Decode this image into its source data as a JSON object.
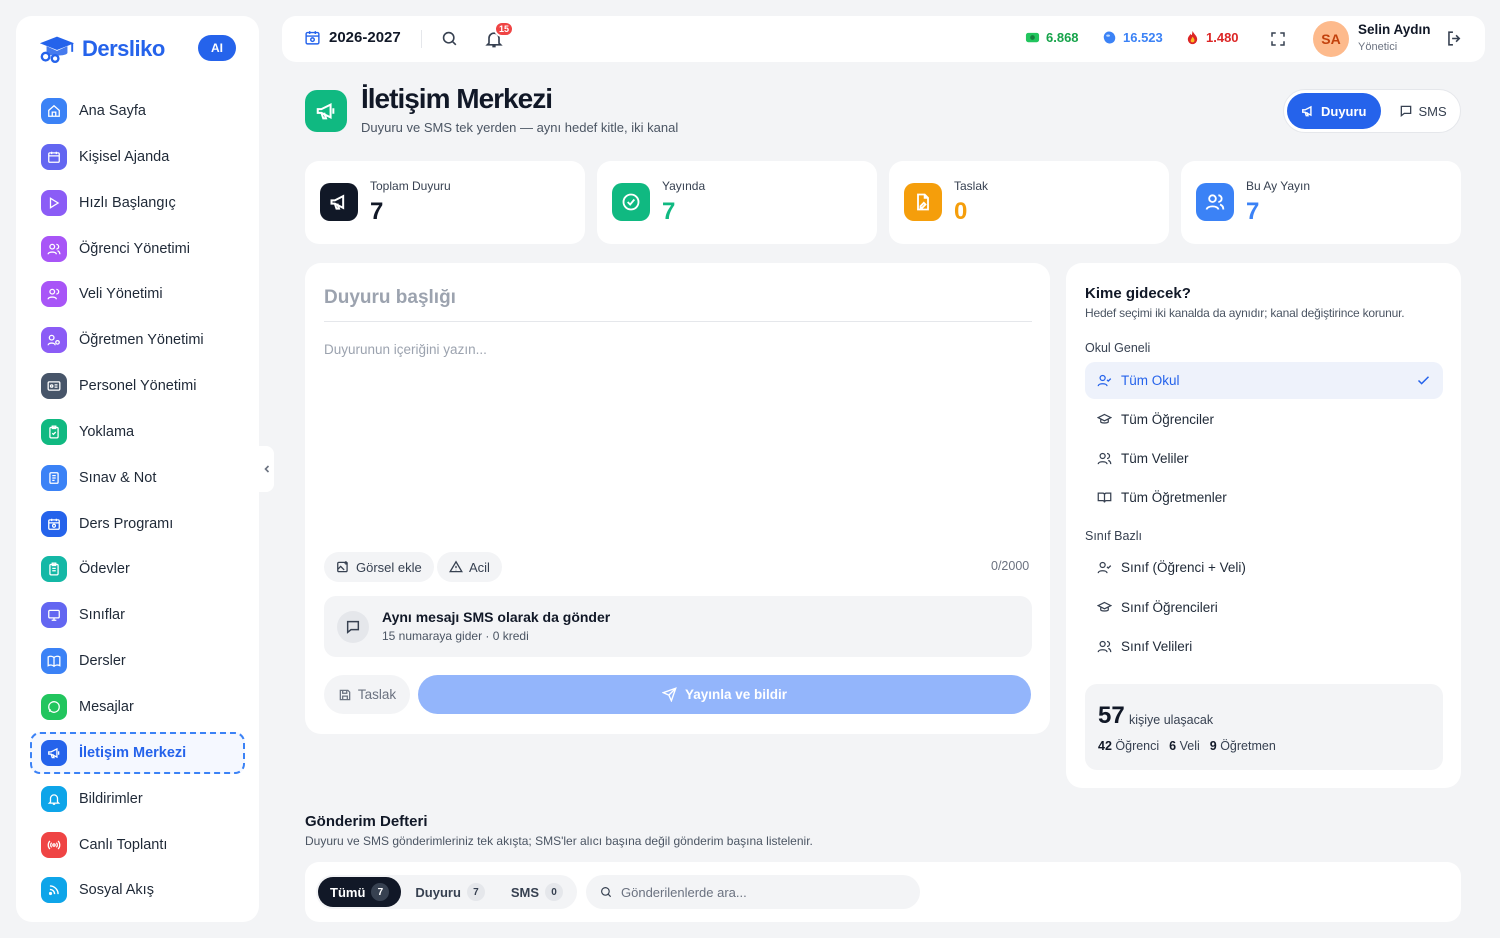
{
  "brand": {
    "name": "Dersliko",
    "ai_label": "AI",
    "color": "#2563eb"
  },
  "sidebar": {
    "items": [
      {
        "label": "Ana Sayfa",
        "icon": "home-icon",
        "color": "#3b82f6"
      },
      {
        "label": "Kişisel Ajanda",
        "icon": "calendar-icon",
        "color": "#6366f1"
      },
      {
        "label": "Hızlı Başlangıç",
        "icon": "play-icon",
        "color": "#8b5cf6"
      },
      {
        "label": "Öğrenci Yönetimi",
        "icon": "users-icon",
        "color": "#a855f7"
      },
      {
        "label": "Veli Yönetimi",
        "icon": "user-group-icon",
        "color": "#a855f7"
      },
      {
        "label": "Öğretmen Yönetimi",
        "icon": "teacher-icon",
        "color": "#8b5cf6"
      },
      {
        "label": "Personel Yönetimi",
        "icon": "id-card-icon",
        "color": "#475569"
      },
      {
        "label": "Yoklama",
        "icon": "clipboard-check-icon",
        "color": "#10b981"
      },
      {
        "label": "Sınav & Not",
        "icon": "exam-icon",
        "color": "#3b82f6"
      },
      {
        "label": "Ders Programı",
        "icon": "schedule-icon",
        "color": "#2563eb"
      },
      {
        "label": "Ödevler",
        "icon": "homework-icon",
        "color": "#14b8a6"
      },
      {
        "label": "Sınıflar",
        "icon": "monitor-icon",
        "color": "#6366f1"
      },
      {
        "label": "Dersler",
        "icon": "book-icon",
        "color": "#3b82f6"
      },
      {
        "label": "Mesajlar",
        "icon": "chat-icon",
        "color": "#22c55e"
      },
      {
        "label": "İletişim Merkezi",
        "icon": "megaphone-icon",
        "color": "#2563eb",
        "active": true
      },
      {
        "label": "Bildirimler",
        "icon": "bell-icon",
        "color": "#0ea5e9"
      },
      {
        "label": "Canlı Toplantı",
        "icon": "broadcast-icon",
        "color": "#ef4444"
      },
      {
        "label": "Sosyal Akış",
        "icon": "rss-icon",
        "color": "#0ea5e9"
      }
    ]
  },
  "topbar": {
    "year": "2026-2027",
    "notification_count": "15",
    "stats": [
      {
        "value": "6.868",
        "icon": "cash-icon",
        "color": "#16a34a"
      },
      {
        "value": "16.523",
        "icon": "gem-icon",
        "color": "#3b82f6"
      },
      {
        "value": "1.480",
        "icon": "flame-icon",
        "color": "#dc2626"
      }
    ],
    "user": {
      "initials": "SA",
      "name": "Selin Aydın",
      "role": "Yönetici"
    }
  },
  "page": {
    "title": "İletişim Merkezi",
    "subtitle": "Duyuru ve SMS tek yerden — aynı hedef kitle, iki kanal",
    "mode_tabs": [
      {
        "label": "Duyuru",
        "active": true
      },
      {
        "label": "SMS",
        "active": false
      }
    ]
  },
  "stat_cards": [
    {
      "label": "Toplam Duyuru",
      "value": "7",
      "color": "#111827",
      "icon": "megaphone-icon"
    },
    {
      "label": "Yayında",
      "value": "7",
      "color": "#10b981",
      "icon": "check-circle-icon"
    },
    {
      "label": "Taslak",
      "value": "0",
      "color": "#f59e0b",
      "icon": "draft-icon"
    },
    {
      "label": "Bu Ay Yayın",
      "value": "7",
      "color": "#3b82f6",
      "icon": "users-icon"
    }
  ],
  "editor": {
    "title_placeholder": "Duyuru başlığı",
    "body_placeholder": "Duyurunun içeriğini yazın...",
    "add_image": "Görsel ekle",
    "urgent": "Acil",
    "counter": "0/2000",
    "sms_option_title": "Aynı mesajı SMS olarak da gönder",
    "sms_option_sub": "15 numaraya gider · 0 kredi",
    "draft_button": "Taslak",
    "publish_button": "Yayınla ve bildir"
  },
  "audience": {
    "title": "Kime gidecek?",
    "subtitle": "Hedef seçimi iki kanalda da aynıdır; kanal değiştirince korunur.",
    "school_section": "Okul Geneli",
    "school_options": [
      {
        "label": "Tüm Okul",
        "selected": true
      },
      {
        "label": "Tüm Öğrenciler",
        "selected": false
      },
      {
        "label": "Tüm Veliler",
        "selected": false
      },
      {
        "label": "Tüm Öğretmenler",
        "selected": false
      }
    ],
    "class_section": "Sınıf Bazlı",
    "class_options": [
      {
        "label": "Sınıf (Öğrenci + Veli)"
      },
      {
        "label": "Sınıf Öğrencileri"
      },
      {
        "label": "Sınıf Velileri"
      }
    ],
    "reach": {
      "count": "57",
      "label": "kişiye ulaşacak",
      "students_n": "42",
      "students_l": "Öğrenci",
      "parents_n": "6",
      "parents_l": "Veli",
      "teachers_n": "9",
      "teachers_l": "Öğretmen"
    }
  },
  "log": {
    "title": "Gönderim Defteri",
    "subtitle": "Duyuru ve SMS gönderimleriniz tek akışta; SMS'ler alıcı başına değil gönderim başına listelenir.",
    "tabs": [
      {
        "label": "Tümü",
        "count": "7",
        "active": true
      },
      {
        "label": "Duyuru",
        "count": "7",
        "active": false
      },
      {
        "label": "SMS",
        "count": "0",
        "active": false
      }
    ],
    "search_placeholder": "Gönderilenlerde ara..."
  }
}
